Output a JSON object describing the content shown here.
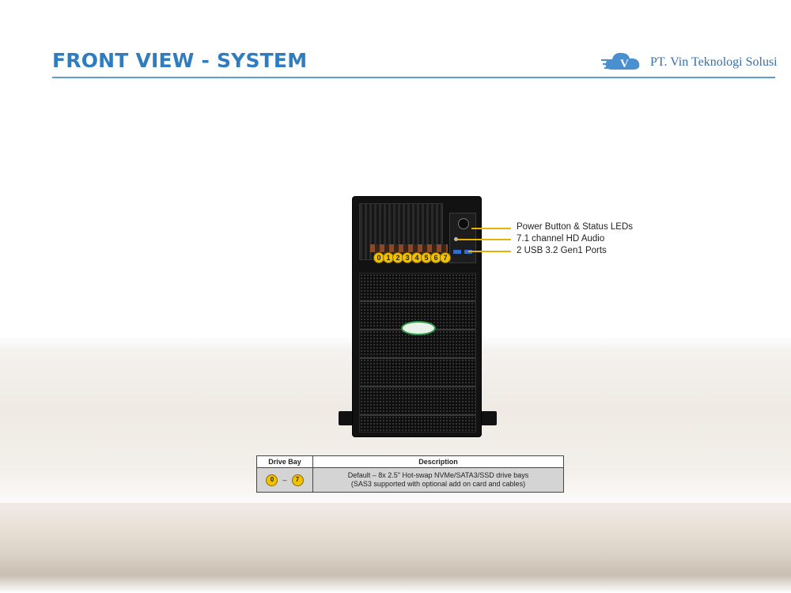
{
  "header": {
    "title": "FRONT VIEW - SYSTEM",
    "company": "PT. Vin Teknologi Solusi"
  },
  "colors": {
    "title": "#2f7cbf",
    "accent_callout": "#e8b200",
    "badge": "#f2c200"
  },
  "server": {
    "bays": [
      "0",
      "1",
      "2",
      "3",
      "4",
      "5",
      "6",
      "7"
    ]
  },
  "callouts": [
    {
      "label": "Power Button & Status LEDs"
    },
    {
      "label": "7.1 channel HD Audio"
    },
    {
      "label": "2 USB 3.2 Gen1 Ports"
    }
  ],
  "table": {
    "headers": [
      "Drive Bay",
      "Description"
    ],
    "row": {
      "range_start": "0",
      "range_sep": "–",
      "range_end": "7",
      "desc_line1": "Default – 8x 2.5\" Hot-swap NVMe/SATA3/SSD drive bays",
      "desc_line2": "(SAS3 supported with optional add on card and cables)"
    }
  }
}
